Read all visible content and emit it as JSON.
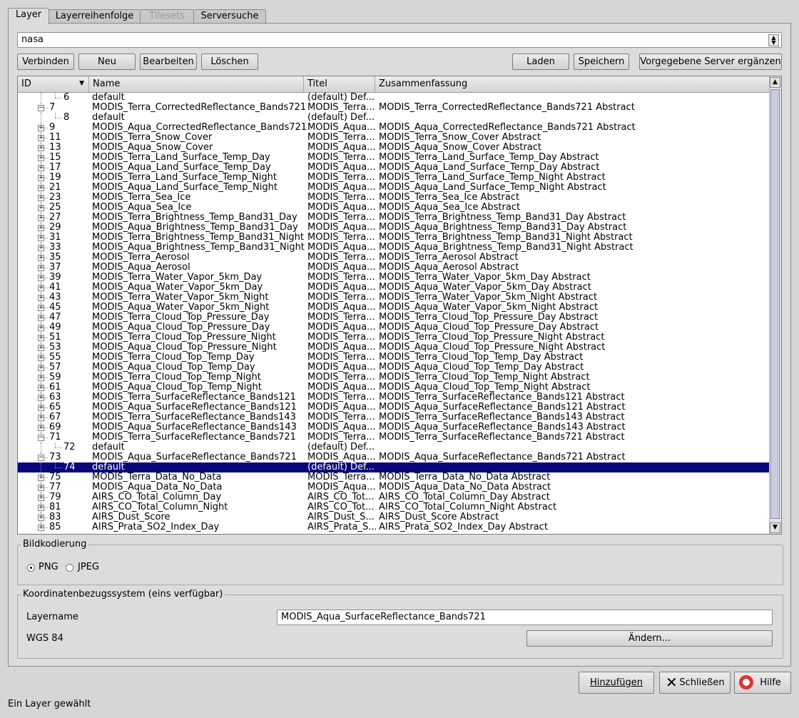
{
  "tabs": [
    {
      "label": "Layer",
      "active": true
    },
    {
      "label": "Layerreihenfolge",
      "active": false
    },
    {
      "label": "Tilesets",
      "active": false,
      "disabled": true
    },
    {
      "label": "Serversuche",
      "active": false
    }
  ],
  "server_select": {
    "value": "nasa"
  },
  "buttons": {
    "connect": "Verbinden",
    "new": "Neu",
    "edit": "Bearbeiten",
    "delete": "Löschen",
    "load": "Laden",
    "save": "Speichern",
    "add_default": "Vorgegebene Server ergänzen"
  },
  "tree": {
    "columns": {
      "id": "ID",
      "name": "Name",
      "title": "Titel",
      "abstract": "Zusammenfassung"
    },
    "rows": [
      {
        "id": "6",
        "name": "default",
        "title": "(default) Def...",
        "abstract": "",
        "level": 2,
        "exp": ""
      },
      {
        "id": "7",
        "name": "MODIS_Terra_CorrectedReflectance_Bands721",
        "title": "MODIS_Terra...",
        "abstract": "MODIS_Terra_CorrectedReflectance_Bands721 Abstract",
        "level": 1,
        "exp": "-"
      },
      {
        "id": "8",
        "name": "default",
        "title": "(default) Def...",
        "abstract": "",
        "level": 2,
        "exp": ""
      },
      {
        "id": "9",
        "name": "MODIS_Aqua_CorrectedReflectance_Bands721",
        "title": "MODIS_Aqua...",
        "abstract": "MODIS_Aqua_CorrectedReflectance_Bands721 Abstract",
        "level": 1,
        "exp": "+"
      },
      {
        "id": "11",
        "name": "MODIS_Terra_Snow_Cover",
        "title": "MODIS_Terra...",
        "abstract": "MODIS_Terra_Snow_Cover Abstract",
        "level": 1,
        "exp": "+"
      },
      {
        "id": "13",
        "name": "MODIS_Aqua_Snow_Cover",
        "title": "MODIS_Aqua...",
        "abstract": "MODIS_Aqua_Snow_Cover Abstract",
        "level": 1,
        "exp": "+"
      },
      {
        "id": "15",
        "name": "MODIS_Terra_Land_Surface_Temp_Day",
        "title": "MODIS_Terra...",
        "abstract": "MODIS_Terra_Land_Surface_Temp_Day Abstract",
        "level": 1,
        "exp": "+"
      },
      {
        "id": "17",
        "name": "MODIS_Aqua_Land_Surface_Temp_Day",
        "title": "MODIS_Aqua...",
        "abstract": "MODIS_Aqua_Land_Surface_Temp_Day Abstract",
        "level": 1,
        "exp": "+"
      },
      {
        "id": "19",
        "name": "MODIS_Terra_Land_Surface_Temp_Night",
        "title": "MODIS_Terra...",
        "abstract": "MODIS_Terra_Land_Surface_Temp_Night Abstract",
        "level": 1,
        "exp": "+"
      },
      {
        "id": "21",
        "name": "MODIS_Aqua_Land_Surface_Temp_Night",
        "title": "MODIS_Aqua...",
        "abstract": "MODIS_Aqua_Land_Surface_Temp_Night Abstract",
        "level": 1,
        "exp": "+"
      },
      {
        "id": "23",
        "name": "MODIS_Terra_Sea_Ice",
        "title": "MODIS_Terra...",
        "abstract": "MODIS_Terra_Sea_Ice Abstract",
        "level": 1,
        "exp": "+"
      },
      {
        "id": "25",
        "name": "MODIS_Aqua_Sea_Ice",
        "title": "MODIS_Aqua...",
        "abstract": "MODIS_Aqua_Sea_Ice Abstract",
        "level": 1,
        "exp": "+"
      },
      {
        "id": "27",
        "name": "MODIS_Terra_Brightness_Temp_Band31_Day",
        "title": "MODIS_Terra...",
        "abstract": "MODIS_Terra_Brightness_Temp_Band31_Day Abstract",
        "level": 1,
        "exp": "+"
      },
      {
        "id": "29",
        "name": "MODIS_Aqua_Brightness_Temp_Band31_Day",
        "title": "MODIS_Aqua...",
        "abstract": "MODIS_Aqua_Brightness_Temp_Band31_Day Abstract",
        "level": 1,
        "exp": "+"
      },
      {
        "id": "31",
        "name": "MODIS_Terra_Brightness_Temp_Band31_Night",
        "title": "MODIS_Terra...",
        "abstract": "MODIS_Terra_Brightness_Temp_Band31_Night Abstract",
        "level": 1,
        "exp": "+"
      },
      {
        "id": "33",
        "name": "MODIS_Aqua_Brightness_Temp_Band31_Night",
        "title": "MODIS_Aqua...",
        "abstract": "MODIS_Aqua_Brightness_Temp_Band31_Night Abstract",
        "level": 1,
        "exp": "+"
      },
      {
        "id": "35",
        "name": "MODIS_Terra_Aerosol",
        "title": "MODIS_Terra...",
        "abstract": "MODIS_Terra_Aerosol Abstract",
        "level": 1,
        "exp": "+"
      },
      {
        "id": "37",
        "name": "MODIS_Aqua_Aerosol",
        "title": "MODIS_Aqua...",
        "abstract": "MODIS_Aqua_Aerosol Abstract",
        "level": 1,
        "exp": "+"
      },
      {
        "id": "39",
        "name": "MODIS_Terra_Water_Vapor_5km_Day",
        "title": "MODIS_Terra...",
        "abstract": "MODIS_Terra_Water_Vapor_5km_Day Abstract",
        "level": 1,
        "exp": "+"
      },
      {
        "id": "41",
        "name": "MODIS_Aqua_Water_Vapor_5km_Day",
        "title": "MODIS_Aqua...",
        "abstract": "MODIS_Aqua_Water_Vapor_5km_Day Abstract",
        "level": 1,
        "exp": "+"
      },
      {
        "id": "43",
        "name": "MODIS_Terra_Water_Vapor_5km_Night",
        "title": "MODIS_Terra...",
        "abstract": "MODIS_Terra_Water_Vapor_5km_Night Abstract",
        "level": 1,
        "exp": "+"
      },
      {
        "id": "45",
        "name": "MODIS_Aqua_Water_Vapor_5km_Night",
        "title": "MODIS_Aqua...",
        "abstract": "MODIS_Aqua_Water_Vapor_5km_Night Abstract",
        "level": 1,
        "exp": "+"
      },
      {
        "id": "47",
        "name": "MODIS_Terra_Cloud_Top_Pressure_Day",
        "title": "MODIS_Terra...",
        "abstract": "MODIS_Terra_Cloud_Top_Pressure_Day Abstract",
        "level": 1,
        "exp": "+"
      },
      {
        "id": "49",
        "name": "MODIS_Aqua_Cloud_Top_Pressure_Day",
        "title": "MODIS_Aqua...",
        "abstract": "MODIS_Aqua_Cloud_Top_Pressure_Day Abstract",
        "level": 1,
        "exp": "+"
      },
      {
        "id": "51",
        "name": "MODIS_Terra_Cloud_Top_Pressure_Night",
        "title": "MODIS_Terra...",
        "abstract": "MODIS_Terra_Cloud_Top_Pressure_Night Abstract",
        "level": 1,
        "exp": "+"
      },
      {
        "id": "53",
        "name": "MODIS_Aqua_Cloud_Top_Pressure_Night",
        "title": "MODIS_Aqua...",
        "abstract": "MODIS_Aqua_Cloud_Top_Pressure_Night Abstract",
        "level": 1,
        "exp": "+"
      },
      {
        "id": "55",
        "name": "MODIS_Terra_Cloud_Top_Temp_Day",
        "title": "MODIS_Terra...",
        "abstract": "MODIS_Terra_Cloud_Top_Temp_Day Abstract",
        "level": 1,
        "exp": "+"
      },
      {
        "id": "57",
        "name": "MODIS_Aqua_Cloud_Top_Temp_Day",
        "title": "MODIS_Aqua...",
        "abstract": "MODIS_Aqua_Cloud_Top_Temp_Day Abstract",
        "level": 1,
        "exp": "+"
      },
      {
        "id": "59",
        "name": "MODIS_Terra_Cloud_Top_Temp_Night",
        "title": "MODIS_Terra...",
        "abstract": "MODIS_Terra_Cloud_Top_Temp_Night Abstract",
        "level": 1,
        "exp": "+"
      },
      {
        "id": "61",
        "name": "MODIS_Aqua_Cloud_Top_Temp_Night",
        "title": "MODIS_Aqua...",
        "abstract": "MODIS_Aqua_Cloud_Top_Temp_Night Abstract",
        "level": 1,
        "exp": "+"
      },
      {
        "id": "63",
        "name": "MODIS_Terra_SurfaceReflectance_Bands121",
        "title": "MODIS_Terra...",
        "abstract": "MODIS_Terra_SurfaceReflectance_Bands121 Abstract",
        "level": 1,
        "exp": "+"
      },
      {
        "id": "65",
        "name": "MODIS_Aqua_SurfaceReflectance_Bands121",
        "title": "MODIS_Aqua...",
        "abstract": "MODIS_Aqua_SurfaceReflectance_Bands121 Abstract",
        "level": 1,
        "exp": "+"
      },
      {
        "id": "67",
        "name": "MODIS_Terra_SurfaceReflectance_Bands143",
        "title": "MODIS_Terra...",
        "abstract": "MODIS_Terra_SurfaceReflectance_Bands143 Abstract",
        "level": 1,
        "exp": "+"
      },
      {
        "id": "69",
        "name": "MODIS_Aqua_SurfaceReflectance_Bands143",
        "title": "MODIS_Aqua...",
        "abstract": "MODIS_Aqua_SurfaceReflectance_Bands143 Abstract",
        "level": 1,
        "exp": "+"
      },
      {
        "id": "71",
        "name": "MODIS_Terra_SurfaceReflectance_Bands721",
        "title": "MODIS_Terra...",
        "abstract": "MODIS_Terra_SurfaceReflectance_Bands721 Abstract",
        "level": 1,
        "exp": "-"
      },
      {
        "id": "72",
        "name": "default",
        "title": "(default) Def...",
        "abstract": "",
        "level": 2,
        "exp": ""
      },
      {
        "id": "73",
        "name": "MODIS_Aqua_SurfaceReflectance_Bands721",
        "title": "MODIS_Aqua...",
        "abstract": "MODIS_Aqua_SurfaceReflectance_Bands721 Abstract",
        "level": 1,
        "exp": "-"
      },
      {
        "id": "74",
        "name": "default",
        "title": "(default) Def...",
        "abstract": "",
        "level": 2,
        "exp": "",
        "selected": true
      },
      {
        "id": "75",
        "name": "MODIS_Terra_Data_No_Data",
        "title": "MODIS_Terra...",
        "abstract": "MODIS_Terra_Data_No_Data Abstract",
        "level": 1,
        "exp": "+"
      },
      {
        "id": "77",
        "name": "MODIS_Aqua_Data_No_Data",
        "title": "MODIS_Aqua...",
        "abstract": "MODIS_Aqua_Data_No_Data Abstract",
        "level": 1,
        "exp": "+"
      },
      {
        "id": "79",
        "name": "AIRS_CO_Total_Column_Day",
        "title": "AIRS_CO_Tot...",
        "abstract": "AIRS_CO_Total_Column_Day Abstract",
        "level": 1,
        "exp": "+"
      },
      {
        "id": "81",
        "name": "AIRS_CO_Total_Column_Night",
        "title": "AIRS_CO_Tot...",
        "abstract": "AIRS_CO_Total_Column_Night Abstract",
        "level": 1,
        "exp": "+"
      },
      {
        "id": "83",
        "name": "AIRS_Dust_Score",
        "title": "AIRS_Dust_S...",
        "abstract": "AIRS_Dust_Score Abstract",
        "level": 1,
        "exp": "+"
      },
      {
        "id": "85",
        "name": "AIRS_Prata_SO2_Index_Day",
        "title": "AIRS_Prata_S...",
        "abstract": "AIRS_Prata_SO2_Index_Day Abstract",
        "level": 1,
        "exp": "+"
      }
    ]
  },
  "image_encoding": {
    "label": "Bildkodierung",
    "options": [
      "PNG",
      "JPEG"
    ],
    "selected": "PNG"
  },
  "crs": {
    "label": "Koordinatenbezugssystem (eins verfügbar)",
    "layername_label": "Layername",
    "layername_value": "MODIS_Aqua_SurfaceReflectance_Bands721",
    "crs_name": "WGS 84",
    "change_button": "Ändern..."
  },
  "footer": {
    "add": "Hinzufügen",
    "close": "Schließen",
    "help": "Hilfe"
  },
  "status": "Ein Layer gewählt",
  "colors": {
    "selection": "#080878",
    "panel": "#dcdcdc",
    "window": "#d6d6d6"
  }
}
